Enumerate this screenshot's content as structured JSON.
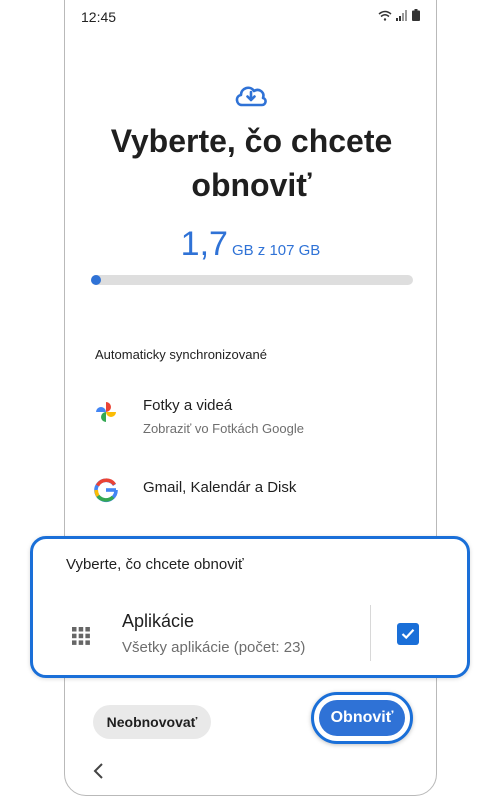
{
  "status_bar": {
    "time": "12:45"
  },
  "page": {
    "title": "Vyberte, čo chcete obnoviť"
  },
  "storage": {
    "used": "1,7",
    "total": "GB z 107 GB",
    "progress_fraction": 0.016
  },
  "section": {
    "label": "Automaticky synchronizované"
  },
  "items": [
    {
      "title": "Fotky a videá",
      "subtitle": "Zobraziť vo Fotkách Google",
      "icon": "google-photos-icon"
    },
    {
      "title": "Gmail, Kalendár a Disk",
      "icon": "google-icon"
    }
  ],
  "highlight_card": {
    "heading": "Vyberte, čo chcete obnoviť",
    "app_title": "Aplikácie",
    "app_subtitle": "Všetky aplikácie (počet: 23)",
    "checked": true,
    "icon": "apps-grid-icon"
  },
  "buttons": {
    "skip": "Neobnovovať",
    "restore": "Obnoviť"
  },
  "colors": {
    "accent": "#2f72d6",
    "highlight": "#1a6fd8"
  }
}
